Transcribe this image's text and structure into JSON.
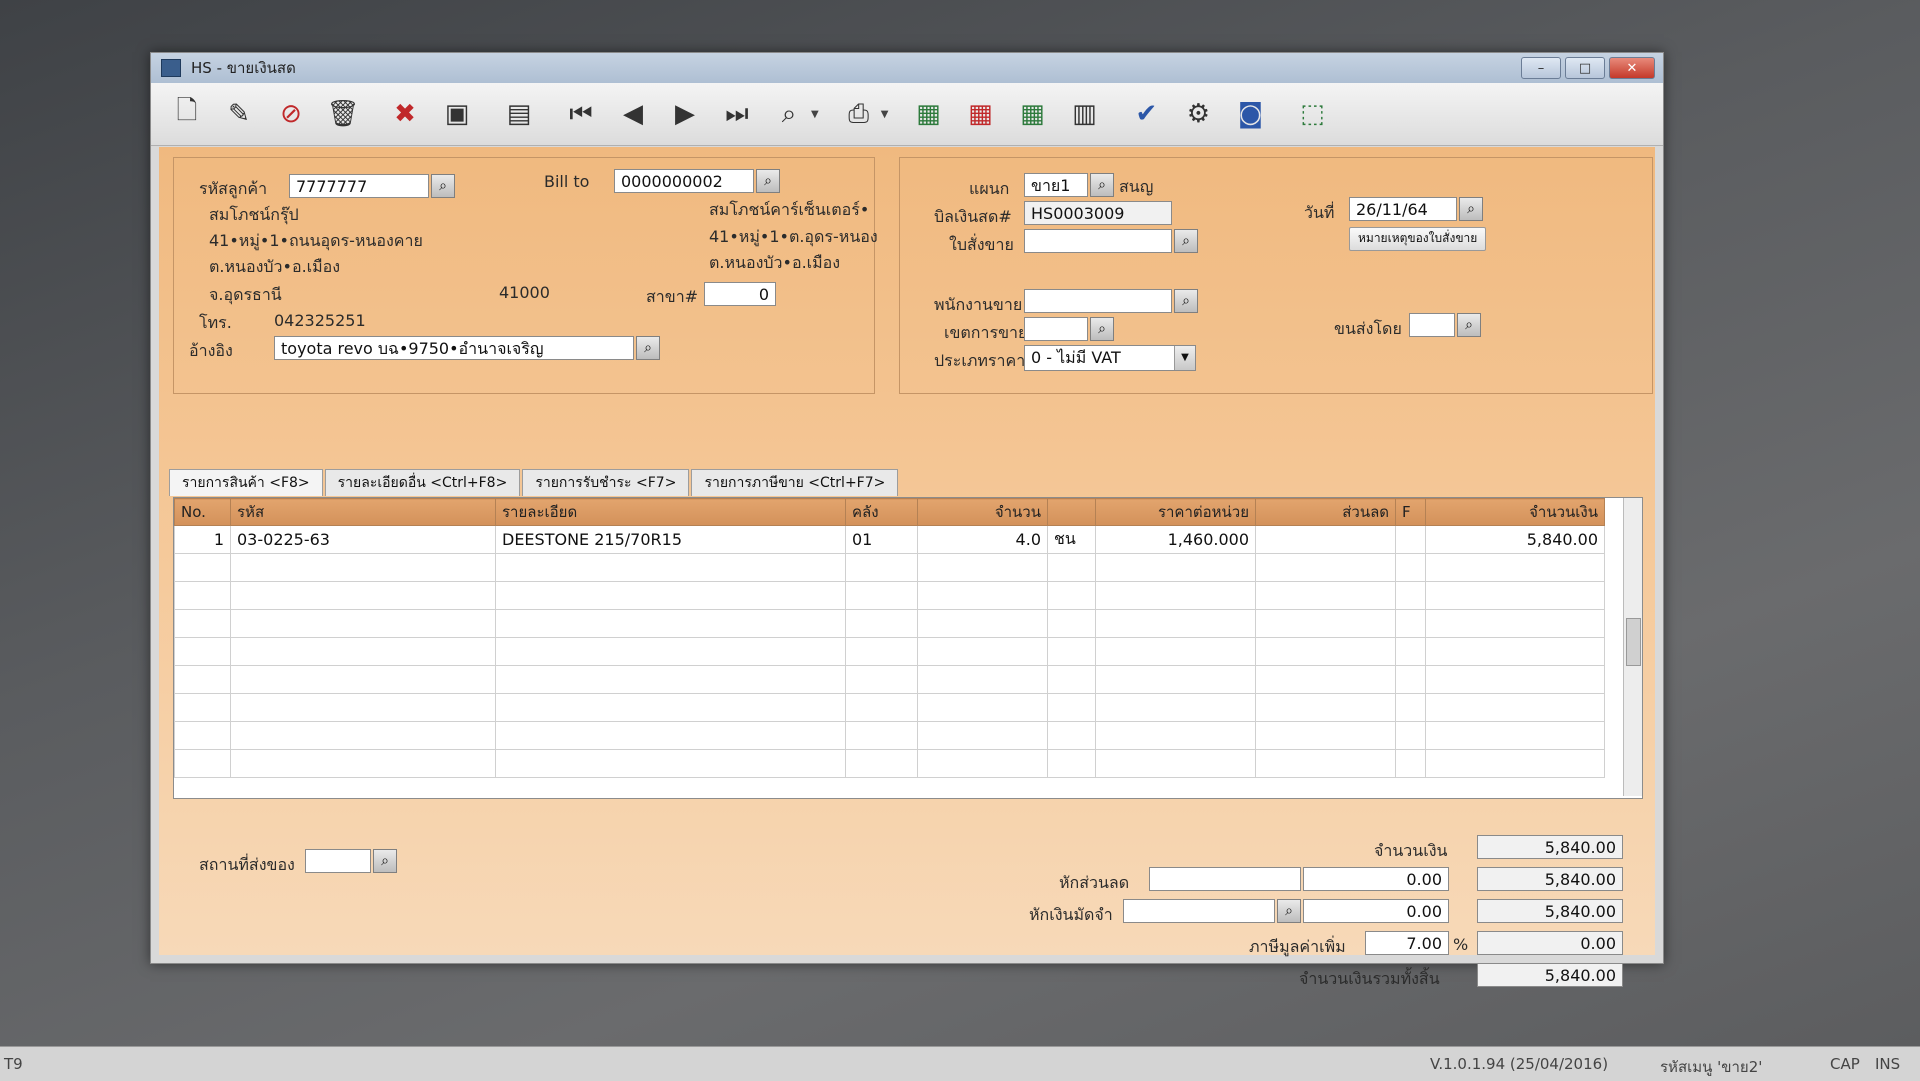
{
  "window": {
    "title": "HS - ขายเงินสด",
    "controls": {
      "minimize": "–",
      "maximize": "□",
      "close": "✕"
    }
  },
  "toolbar": {
    "icons": [
      "new-doc-icon",
      "edit-icon",
      "cancel-doc-icon",
      "delete-icon",
      "close-red-icon",
      "save-icon",
      "print-stack-icon",
      "first-record-icon",
      "prev-record-icon",
      "next-record-icon",
      "last-record-icon",
      "search-icon",
      "printer-icon",
      "report-1-icon",
      "report-2-icon",
      "report-3-icon",
      "calendar-icon",
      "approve-ok-icon",
      "link-icon",
      "ok-icon",
      "export-icon"
    ]
  },
  "customer": {
    "code_label": "รหัสลูกค้า",
    "code": "7777777",
    "name": "สมโภชน์กรุ๊ป",
    "address1": "41•หมู่•1•ถนนอุดร-หนองคาย",
    "address2": "ต.หนองบัว•อ.เมือง",
    "province": "จ.อุดรธานี",
    "zip": "41000",
    "phone_label": "โทร.",
    "phone": "042325251",
    "ref_label": "อ้างอิง",
    "ref": "toyota revo บฉ•9750•อำนาจเจริญ"
  },
  "billto": {
    "label": "Bill to",
    "code": "0000000002",
    "name": "สมโภชน์คาร์เซ็นเตอร์•",
    "address1": "41•หมู่•1•ต.อุดร-หนอง",
    "address2": "ต.หนองบัว•อ.เมือง",
    "branch_label": "สาขา#",
    "branch": "0"
  },
  "doc": {
    "dept_label": "แผนก",
    "dept_code": "ขาย1",
    "dept_name": "สนญ",
    "bill_label": "บิลเงินสด#",
    "bill_no": "HS0003009",
    "order_label": "ใบสั่งขาย",
    "order_no": "",
    "note_button": "หมายเหตุของใบสั่งขาย",
    "date_label": "วันที่",
    "date": "26/11/64",
    "salesperson_label": "พนักงานขาย",
    "salesperson": "",
    "area_label": "เขตการขาย",
    "area": "",
    "shipby_label": "ขนส่งโดย",
    "shipby": "",
    "pricetype_label": "ประเภทราคา",
    "pricetype": "0 - ไม่มี VAT"
  },
  "tabs": [
    "รายการสินค้า <F8>",
    "รายละเอียดอื่น <Ctrl+F8>",
    "รายการรับชำระ <F7>",
    "รายการภาษีขาย <Ctrl+F7>"
  ],
  "grid": {
    "headers": [
      "No.",
      "รหัส",
      "รายละเอียด",
      "คลัง",
      "จำนวน",
      "",
      "ราคาต่อหน่วย",
      "ส่วนลด",
      "F",
      "จำนวนเงิน"
    ],
    "rows": [
      [
        "1",
        "03-0225-63",
        "DEESTONE 215/70R15",
        "01",
        "4.0",
        "ชน",
        "1,460.000",
        "",
        "",
        "5,840.00"
      ]
    ],
    "empty_rows": 8
  },
  "totals": {
    "ship_label": "สถานที่ส่งของ",
    "ship_value": "",
    "amount_label": "จำนวนเงิน",
    "amount": "5,840.00",
    "discount_label": "หักส่วนลด",
    "discount_text": "",
    "discount_value": "0.00",
    "after_discount": "5,840.00",
    "deposit_label": "หักเงินมัดจำ",
    "deposit_text": "",
    "deposit_value": "0.00",
    "after_deposit": "5,840.00",
    "vat_label": "ภาษีมูลค่าเพิ่ม",
    "vat_rate": "7.00",
    "vat_pct": "%",
    "vat_amount": "0.00",
    "grand_label": "จำนวนเงินรวมทั้งสิ้น",
    "grand_total": "5,840.00"
  },
  "status": {
    "left": "T9",
    "version": "V.1.0.1.94 (25/04/2016)",
    "menu_code": "รหัสเมนู 'ขาย2'",
    "cap": "CAP",
    "ins": "INS"
  }
}
